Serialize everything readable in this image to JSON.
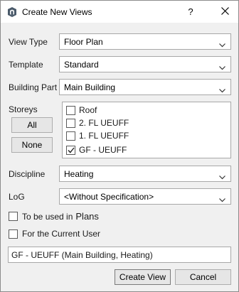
{
  "window": {
    "title": "Create New Views",
    "help_label": "?",
    "icons": {
      "app": "app-logo-icon",
      "close": "close-icon"
    }
  },
  "fields": {
    "view_type": {
      "label": "View Type",
      "value": "Floor Plan"
    },
    "template": {
      "label": "Template",
      "value": "Standard"
    },
    "building_part": {
      "label": "Building Part",
      "value": "Main Building"
    },
    "discipline": {
      "label": "Discipline",
      "value": "Heating"
    },
    "log": {
      "label": "LoG",
      "value": "<Without Specification>"
    }
  },
  "storeys": {
    "label": "Storeys",
    "all_label": "All",
    "none_label": "None",
    "items": [
      {
        "label": "Roof",
        "checked": false
      },
      {
        "label": "2. FL  UEUFF",
        "checked": false
      },
      {
        "label": "1. FL  UEUFF",
        "checked": false
      },
      {
        "label": "GF - UEUFF",
        "checked": true
      }
    ]
  },
  "options": {
    "used_in_label": "To be used in",
    "used_in_value": "Plans",
    "current_user_label": "For the Current User",
    "used_in_checked": false,
    "current_user_checked": false
  },
  "view_name": "GF - UEUFF (Main Building, Heating)",
  "actions": {
    "create_label": "Create View",
    "cancel_label": "Cancel"
  },
  "colors": {
    "window_bg": "#f0f0f0",
    "titlebar_bg": "#ffffff",
    "control_border": "#a8a8a8",
    "button_bg": "#e6e6e6"
  }
}
